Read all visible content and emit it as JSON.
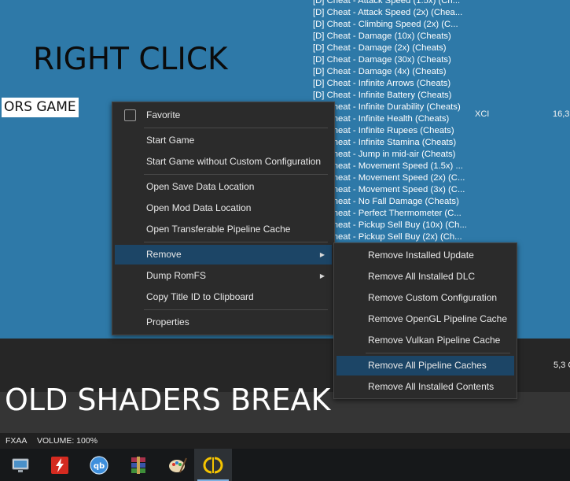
{
  "background": {
    "accent": "#2e79a8",
    "menu_bg": "#2b2b2b",
    "menu_highlight": "#1c4566"
  },
  "overlay": {
    "right_click": "RIGHT CLICK",
    "bottom_caption": "OLD SHADERS BREAK",
    "game_label": "ORS GAME"
  },
  "cheat_list": [
    "[D] Cheat - Attack Speed (1.5x) (Ch...",
    "[D] Cheat - Attack Speed (2x) (Chea...",
    "[D] Cheat - Climbing Speed (2x) (C...",
    "[D] Cheat - Damage (10x) (Cheats)",
    "[D] Cheat - Damage (2x) (Cheats)",
    "[D] Cheat - Damage (30x) (Cheats)",
    "[D] Cheat - Damage (4x) (Cheats)",
    "[D] Cheat - Infinite Arrows (Cheats)",
    "[D] Cheat - Infinite Battery (Cheats)",
    "[D] Cheat - Infinite Durability (Cheats)",
    "[D] Cheat - Infinite Health (Cheats)",
    "[D] Cheat - Infinite Rupees (Cheats)",
    "[D] Cheat - Infinite Stamina (Cheats)",
    "[D] Cheat - Jump in mid-air (Cheats)",
    "[D] Cheat - Movement Speed (1.5x) ...",
    "[D] Cheat - Movement Speed (2x) (C...",
    "[D] Cheat - Movement Speed (3x) (C...",
    "[D] Cheat - No Fall Damage (Cheats)",
    "[D] Cheat - Perfect Thermometer (C...",
    "[D] Cheat - Pickup Sell Buy (10x) (Ch...",
    "[D] Cheat - Pickup Sell Buy (2x) (Ch..."
  ],
  "game_row": {
    "file_type": "XCI",
    "file_size": "16,3",
    "file_size_2": "5,3 G"
  },
  "context_menu": {
    "favorite": "Favorite",
    "start_game": "Start Game",
    "start_game_no_config": "Start Game without Custom Configuration",
    "open_save": "Open Save Data Location",
    "open_mod": "Open Mod Data Location",
    "open_pipeline": "Open Transferable Pipeline Cache",
    "remove": "Remove",
    "dump_romfs": "Dump RomFS",
    "copy_title_id": "Copy Title ID to Clipboard",
    "properties": "Properties"
  },
  "remove_submenu": {
    "installed_update": "Remove Installed Update",
    "all_dlc": "Remove All Installed DLC",
    "custom_config": "Remove Custom Configuration",
    "opengl_cache": "Remove OpenGL Pipeline Cache",
    "vulkan_cache": "Remove Vulkan Pipeline Cache",
    "all_caches": "Remove All Pipeline Caches",
    "all_contents": "Remove All Installed Contents"
  },
  "status_bar": {
    "filter": "FXAA",
    "volume": "VOLUME: 100%"
  },
  "taskbar": {
    "apps": [
      "remote-desktop-icon",
      "flash-app-icon",
      "qbittorrent-icon",
      "winrar-icon",
      "paint-icon",
      "yuzu-icon"
    ]
  }
}
